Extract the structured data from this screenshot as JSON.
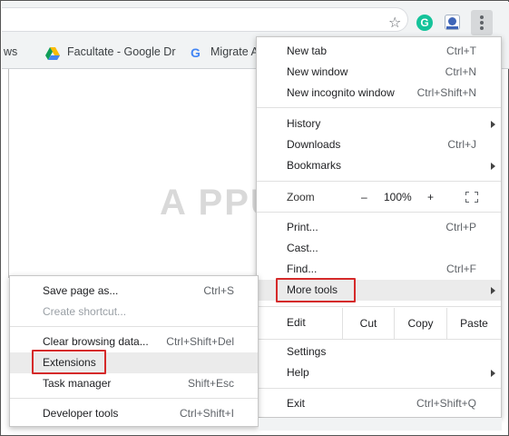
{
  "bookmarks": {
    "partial_left": "ws",
    "item1": "Facultate - Google Dr",
    "item2": "Migrate A"
  },
  "watermark": "A PPUALS",
  "main_menu": {
    "new_tab": {
      "label": "New tab",
      "shortcut": "Ctrl+T"
    },
    "new_window": {
      "label": "New window",
      "shortcut": "Ctrl+N"
    },
    "new_incognito": {
      "label": "New incognito window",
      "shortcut": "Ctrl+Shift+N"
    },
    "history": {
      "label": "History"
    },
    "downloads": {
      "label": "Downloads",
      "shortcut": "Ctrl+J"
    },
    "bookmarks": {
      "label": "Bookmarks"
    },
    "zoom": {
      "label": "Zoom",
      "minus": "–",
      "value": "100%",
      "plus": "+"
    },
    "print": {
      "label": "Print...",
      "shortcut": "Ctrl+P"
    },
    "cast": {
      "label": "Cast..."
    },
    "find": {
      "label": "Find...",
      "shortcut": "Ctrl+F"
    },
    "more_tools": {
      "label": "More tools"
    },
    "edit": {
      "label": "Edit",
      "cut": "Cut",
      "copy": "Copy",
      "paste": "Paste"
    },
    "settings": {
      "label": "Settings"
    },
    "help": {
      "label": "Help"
    },
    "exit": {
      "label": "Exit",
      "shortcut": "Ctrl+Shift+Q"
    }
  },
  "more_tools_menu": {
    "save_page": {
      "label": "Save page as...",
      "shortcut": "Ctrl+S"
    },
    "create_shortcut": {
      "label": "Create shortcut..."
    },
    "clear_data": {
      "label": "Clear browsing data...",
      "shortcut": "Ctrl+Shift+Del"
    },
    "extensions": {
      "label": "Extensions"
    },
    "task_manager": {
      "label": "Task manager",
      "shortcut": "Shift+Esc"
    },
    "developer_tools": {
      "label": "Developer tools",
      "shortcut": "Ctrl+Shift+I"
    }
  },
  "colors": {
    "highlight_box": "#d52a2a",
    "hover_bg": "#ebebeb",
    "toolbar_bg": "#f1f3f4"
  }
}
